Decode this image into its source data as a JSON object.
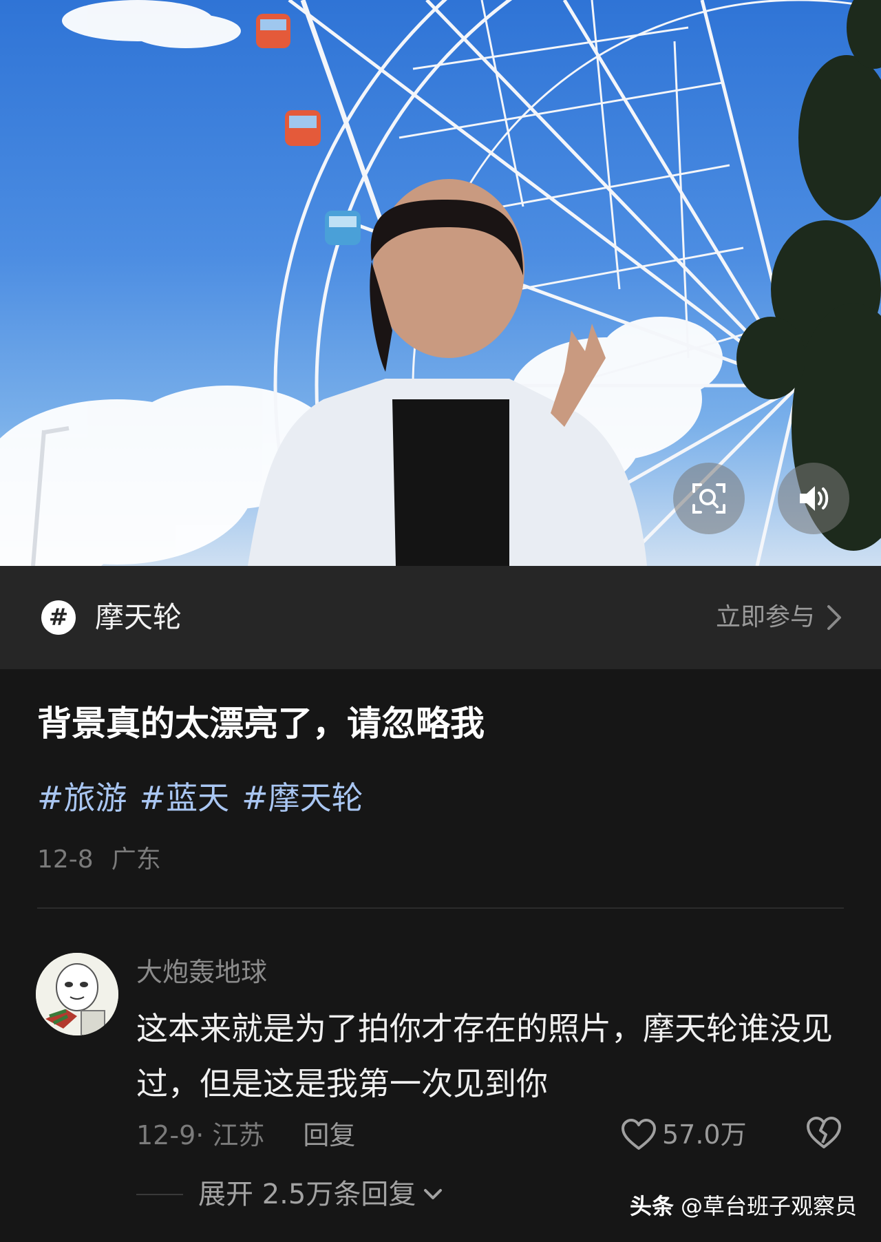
{
  "media": {
    "scan_icon": "scan-icon",
    "sound_icon": "speaker-icon"
  },
  "topic": {
    "hash_symbol": "#",
    "name": "摩天轮",
    "join_label": "立即参与",
    "arrow_icon": "chevron-right-icon"
  },
  "post": {
    "title": "背景真的太漂亮了，请忽略我",
    "tags": [
      "#旅游",
      "#蓝天",
      "#摩天轮"
    ],
    "date": "12-8",
    "location": "广东"
  },
  "comment": {
    "username": "大炮轰地球",
    "text": "这本来就是为了拍你才存在的照片，摩天轮谁没见过，但是这是我第一次见到你",
    "meta": "12-9· 江苏",
    "reply_label": "回复",
    "like_count": "57.0万",
    "like_icon": "heart-outline-icon",
    "dislike_icon": "broken-heart-icon"
  },
  "expand": {
    "label": "展开 2.5万条回复"
  },
  "watermark": {
    "brand": "头条",
    "handle": "@草台班子观察员"
  },
  "colors": {
    "background": "#161616",
    "topic_bar": "#262626",
    "tag_blue": "#a9c6f2",
    "muted_text": "#7b7b7b"
  }
}
